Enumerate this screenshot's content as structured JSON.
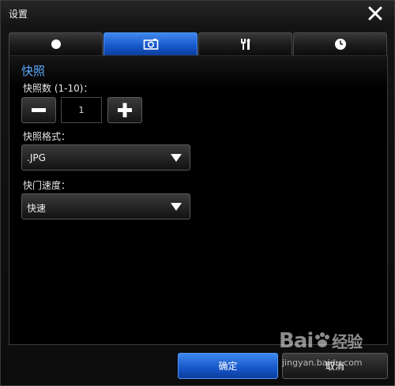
{
  "window": {
    "title": "设置"
  },
  "tabs": [
    {
      "icon": "record-dot-icon",
      "active": false
    },
    {
      "icon": "camera-icon",
      "active": true
    },
    {
      "icon": "tools-icon",
      "active": false
    },
    {
      "icon": "clock-icon",
      "active": false
    }
  ],
  "snapshot": {
    "section_title": "快照",
    "count_label": "快照数 (1-10)：",
    "count_value": "1",
    "format_label": "快照格式：",
    "format_value": ".JPG",
    "shutter_label": "快门速度：",
    "shutter_value": "快速"
  },
  "footer": {
    "ok_label": "确定",
    "cancel_label": "取消"
  },
  "watermark": {
    "logo_text": "Bai",
    "logo_text_2": "经验",
    "url": "jingyan.baidu.com"
  },
  "colors": {
    "accent": "#1f66d8",
    "section_title": "#5aa9ff",
    "background": "#0c0c0c"
  }
}
